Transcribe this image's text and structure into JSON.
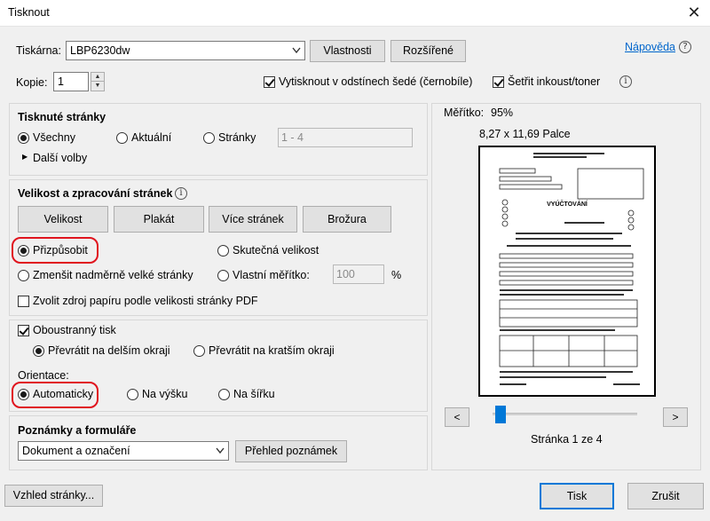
{
  "window": {
    "title": "Tisknout",
    "close_glyph": "✕"
  },
  "printer": {
    "label": "Tiskárna:",
    "selected": "LBP6230dw",
    "properties_label": "Vlastnosti",
    "advanced_label": "Rozšířené",
    "help_label": "Nápověda",
    "help_glyph": "?"
  },
  "copies": {
    "label": "Kopie:",
    "value": "1",
    "grayscale_label": "Vytisknout v odstínech šedé (černobíle)",
    "grayscale_checked": true,
    "save_ink_label": "Šetřit inkoust/toner",
    "save_ink_checked": true,
    "info_glyph": "i"
  },
  "pages_to_print": {
    "title": "Tisknuté stránky",
    "options": [
      {
        "label": "Všechny",
        "selected": true
      },
      {
        "label": "Aktuální",
        "selected": false
      },
      {
        "label": "Stránky",
        "selected": false
      }
    ],
    "pages_value": "1 - 4",
    "more_options": "Další volby",
    "more_glyph": "▶"
  },
  "sizing": {
    "title": "Velikost a zpracování stránek",
    "info_glyph": "i",
    "buttons": [
      "Velikost",
      "Plakát",
      "Více stránek",
      "Brožura"
    ],
    "fit_label": "Přizpůsobit",
    "actual_size_label": "Skutečná velikost",
    "shrink_label": "Zmenšit nadměrně velké stránky",
    "custom_scale_label": "Vlastní měřítko:",
    "custom_scale_value": "100",
    "percent": "%",
    "paper_source_label": "Zvolit zdroj papíru podle velikosti stránky PDF",
    "fit_selected": true
  },
  "duplex": {
    "label": "Oboustranný tisk",
    "checked": true,
    "long_edge_label": "Převrátit na delším okraji",
    "short_edge_label": "Převrátit na kratším okraji"
  },
  "orientation": {
    "label": "Orientace:",
    "auto_label": "Automaticky",
    "portrait_label": "Na výšku",
    "landscape_label": "Na šířku"
  },
  "comments": {
    "title": "Poznámky a formuláře",
    "selected": "Dokument a označení",
    "summary_label": "Přehled poznámek"
  },
  "preview": {
    "scale_label": "Měřítko:",
    "scale_value": "95%",
    "paper_size": "8,27 x 11,69 Palce",
    "prev_glyph": "<",
    "next_glyph": ">",
    "page_status": "Stránka 1 ze 4",
    "slider_fraction": 0.0,
    "doc_heading": "VYÚČTOVÁNÍ"
  },
  "footer": {
    "page_setup_label": "Vzhled stránky...",
    "print_label": "Tisk",
    "cancel_label": "Zrušit"
  },
  "colors": {
    "accent": "#0078d7",
    "highlight": "#e0141e",
    "link": "#0066cc"
  }
}
